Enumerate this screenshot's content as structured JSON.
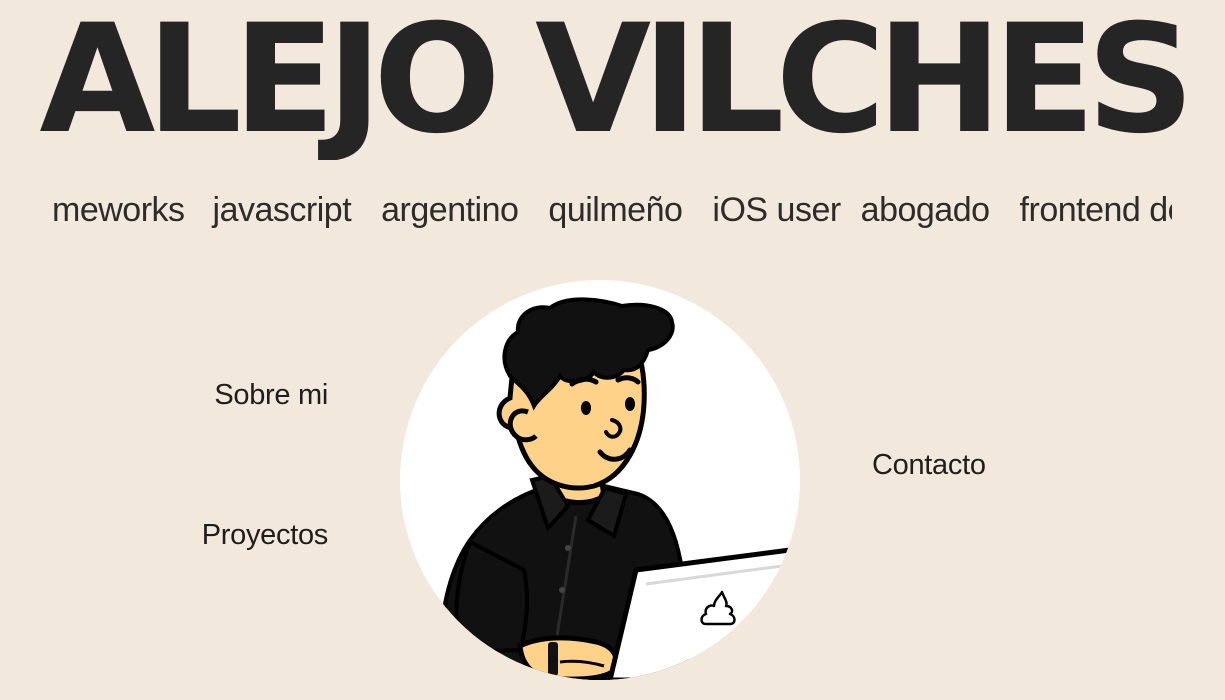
{
  "header": {
    "name": "ALEJO VILCHES"
  },
  "tagline_marquee": {
    "items": [
      "meworks",
      "javascript",
      "argentino",
      "quilmeño",
      "iOS user",
      "abogado",
      "frontend develo"
    ]
  },
  "nav": {
    "about_label": "Sobre mi",
    "projects_label": "Proyectos",
    "contact_label": "Contacto"
  },
  "colors": {
    "background": "#f3e8dc",
    "text": "#252525",
    "avatar_background": "#ffffff",
    "skin": "#ffd28a",
    "hair_and_shirt": "#111111"
  },
  "icons": {
    "avatar": "developer-illustration",
    "laptop_logo": "poop-icon"
  }
}
